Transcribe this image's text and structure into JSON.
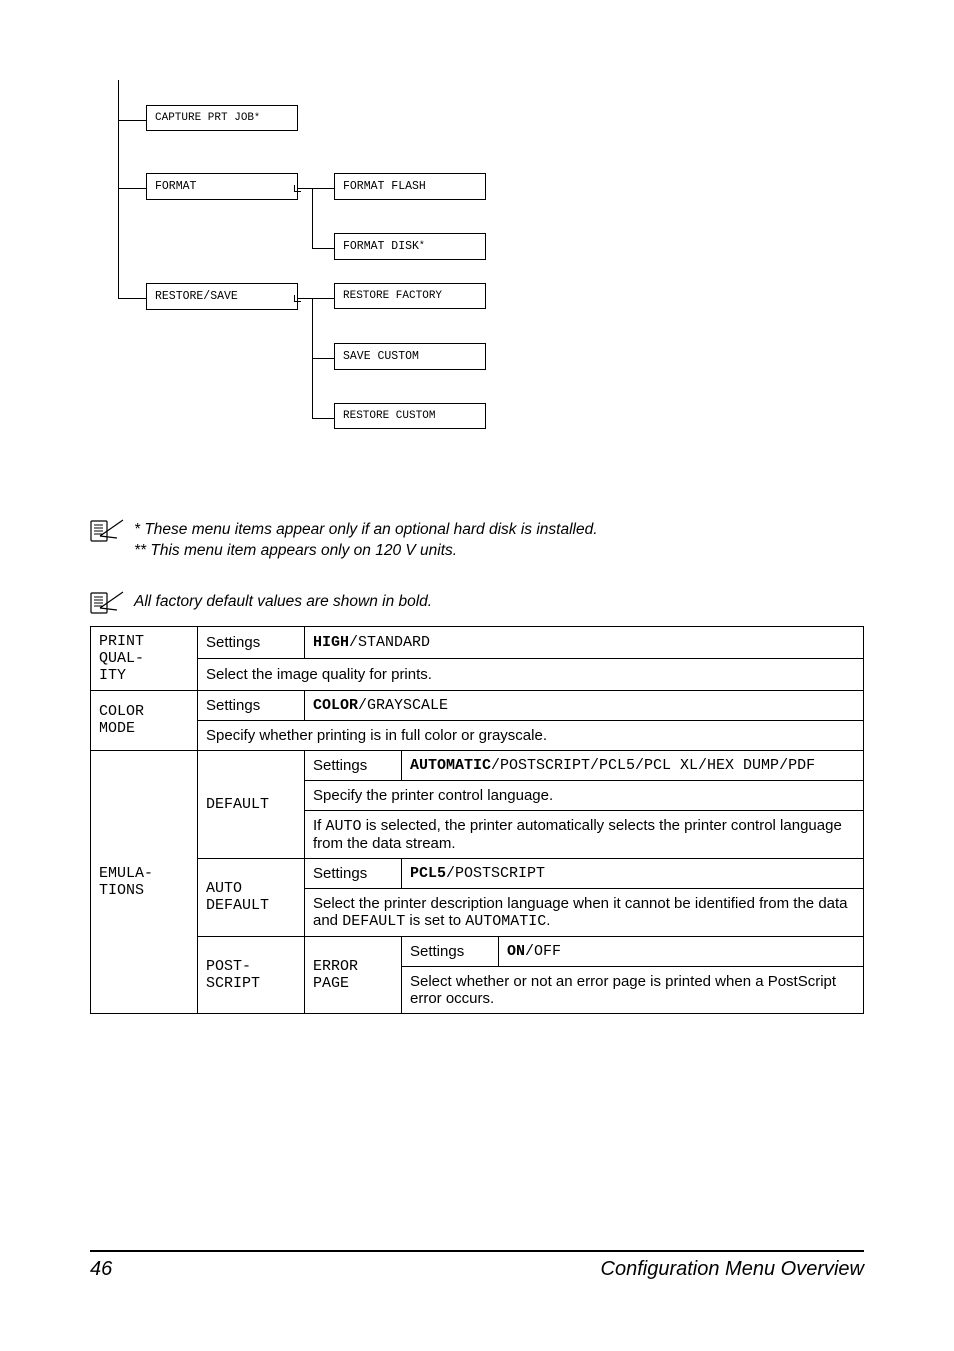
{
  "diagram": {
    "capture_prt_job": "CAPTURE PRT JOB*",
    "format": "FORMAT",
    "format_flash": "FORMAT FLASH",
    "format_disk": "FORMAT DISK*",
    "restore_save": "RESTORE/SAVE",
    "restore_factory": "RESTORE FACTORY",
    "save_custom": "SAVE CUSTOM",
    "restore_custom": "RESTORE CUSTOM"
  },
  "notes": {
    "note1_line1": "* These menu items appear only if an optional hard disk is installed.",
    "note1_line2": "** This menu item appears only on 120 V units.",
    "note2": "All factory default values are shown in bold."
  },
  "table": {
    "print_quality_label": "PRINT QUAL-ITY",
    "settings_label": "Settings",
    "pq_settings_val_bold": "HIGH",
    "pq_settings_val_rest": "/STANDARD",
    "pq_desc": "Select the image quality for prints.",
    "color_mode_label": "COLOR MODE",
    "cm_settings_val_bold": "COLOR",
    "cm_settings_val_rest": "/GRAYSCALE",
    "cm_desc": "Specify whether printing is in full color or grayscale.",
    "emulations_label": "EMULA-TIONS",
    "default_label": "DEFAULT",
    "def_settings_val_bold": "AUTOMATIC",
    "def_settings_val_rest": "/POSTSCRIPT/PCL5/PCL XL/HEX DUMP/PDF",
    "def_desc1": "Specify the printer control language.",
    "def_desc2_a": "If ",
    "def_desc2_code": "AUTO",
    "def_desc2_b": " is selected, the printer automatically selects the printer control language from the data stream.",
    "auto_default_label": "AUTO DEFAULT",
    "ad_settings_val_bold": "PCL5",
    "ad_settings_val_rest": "/POSTSCRIPT",
    "ad_desc_a": "Select the printer description language when it cannot be identified from the data and ",
    "ad_desc_code1": "DEFAULT",
    "ad_desc_b": " is set to ",
    "ad_desc_code2": "AUTOMATIC",
    "ad_desc_c": ".",
    "postscript_label": "POST-SCRIPT",
    "error_page_label": "ERROR PAGE",
    "ep_settings_val_bold": "ON",
    "ep_settings_val_rest": "/OFF",
    "ep_desc": "Select whether or not an error page is printed when a PostScript error occurs."
  },
  "footer": {
    "page": "46",
    "title": "Configuration Menu Overview"
  }
}
